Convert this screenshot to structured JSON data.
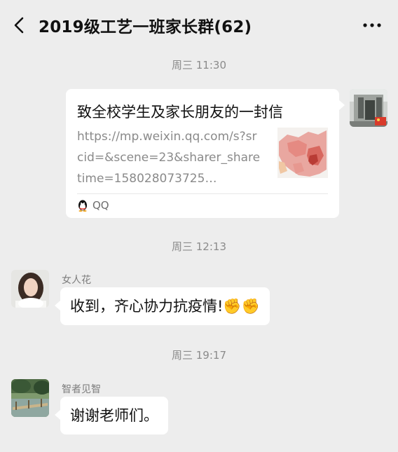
{
  "header": {
    "title": "2019级工艺一班家长群(62)",
    "back_icon": "chevron-left-icon",
    "more_icon": "more-dots-icon"
  },
  "messages": [
    {
      "time": "周三 11:30",
      "card": {
        "title": "致全校学生及家长朋友的一封信",
        "description": "https://mp.weixin.qq.com/s?srcid=&scene=23&sharer_sharetime=158028073725…",
        "source": "QQ",
        "source_icon": "qq-penguin-icon"
      }
    },
    {
      "time": "周三 12:13",
      "sender": "女人花",
      "text": "收到，齐心协力抗疫情!✊✊"
    },
    {
      "time": "周三 19:17",
      "sender": "智者见智",
      "text": "谢谢老师们。"
    }
  ],
  "colors": {
    "background": "#ededed",
    "bubble": "#ffffff",
    "timestamp": "#8b8b8b",
    "sender_name": "#7d7d7d"
  }
}
